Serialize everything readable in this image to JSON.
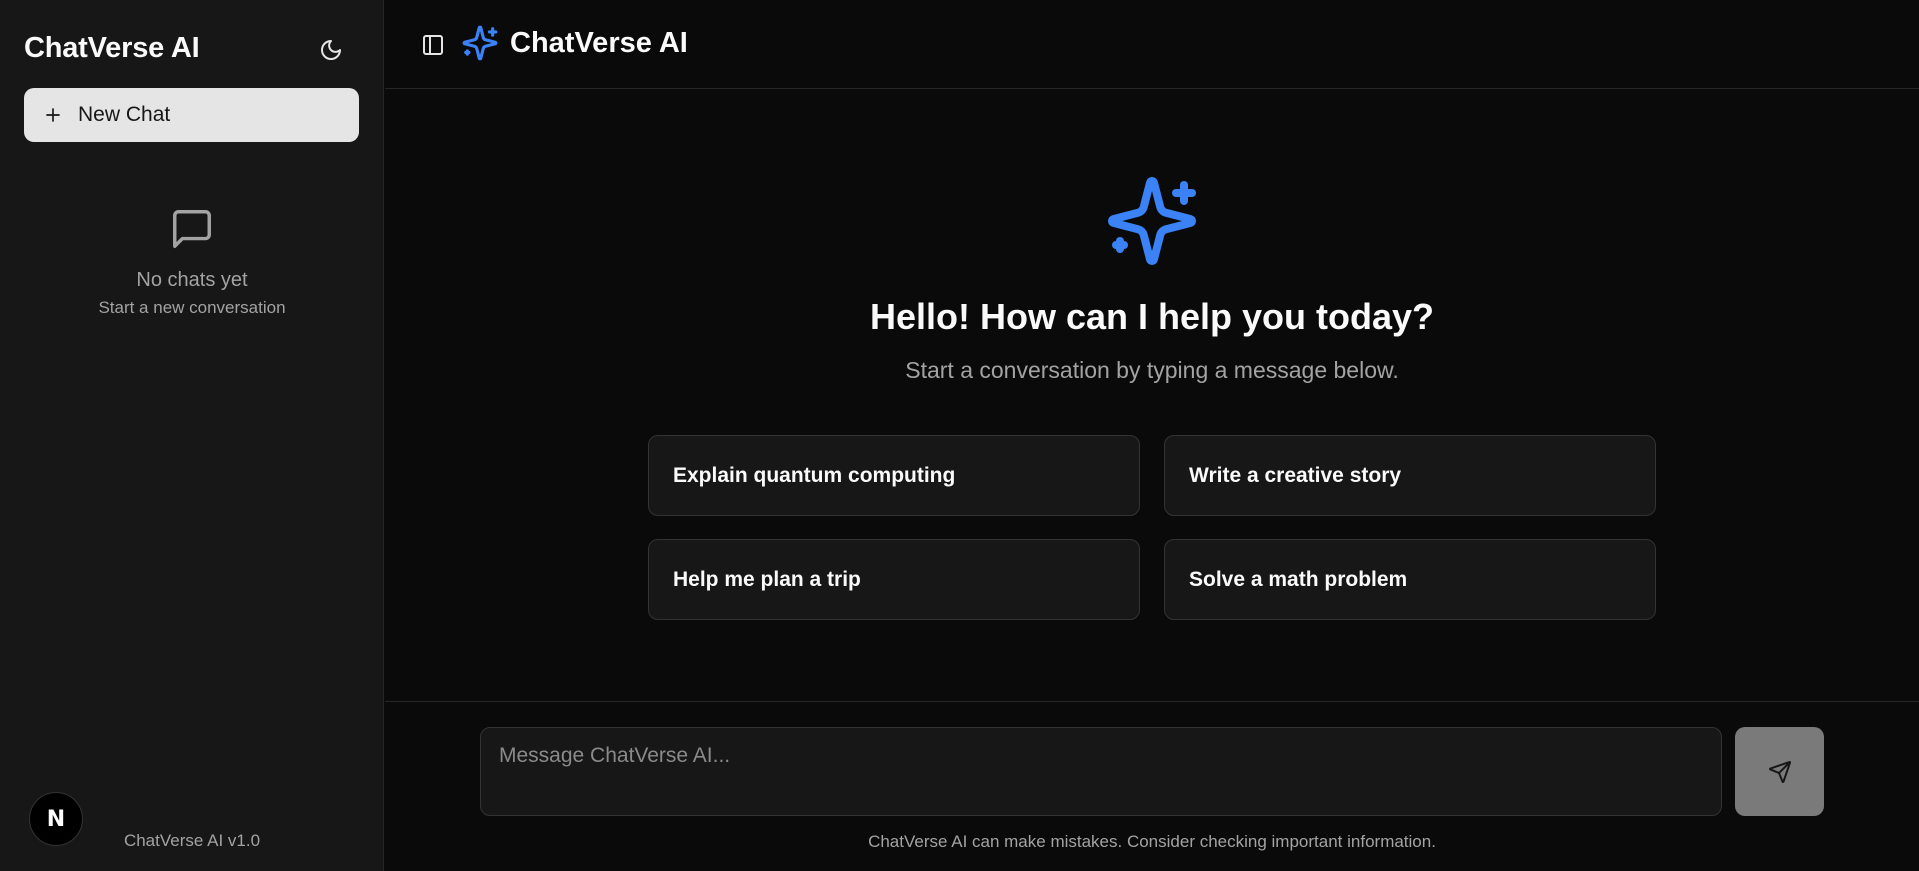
{
  "sidebar": {
    "brand": "ChatVerse AI",
    "new_chat_label": "New Chat",
    "empty_title": "No chats yet",
    "empty_subtitle": "Start a new conversation",
    "avatar_letter": "N",
    "version": "ChatVerse AI v1.0"
  },
  "header": {
    "title": "ChatVerse AI"
  },
  "welcome": {
    "title": "Hello! How can I help you today?",
    "subtitle": "Start a conversation by typing a message below.",
    "suggestions": [
      "Explain quantum computing",
      "Write a creative story",
      "Help me plan a trip",
      "Solve a math problem"
    ]
  },
  "composer": {
    "placeholder": "Message ChatVerse AI...",
    "disclaimer": "ChatVerse AI can make mistakes. Consider checking important information."
  },
  "icons": {
    "theme_toggle": "moon-icon",
    "sidebar_toggle": "panel-left-icon",
    "logo": "sparkles-icon",
    "chat": "message-square-icon",
    "send": "send-icon",
    "new_chat": "plus-icon"
  },
  "colors": {
    "accent": "#3b82f6",
    "background": "#0a0a0a",
    "sidebar": "#171717",
    "send_button": "#7a7a7a"
  }
}
